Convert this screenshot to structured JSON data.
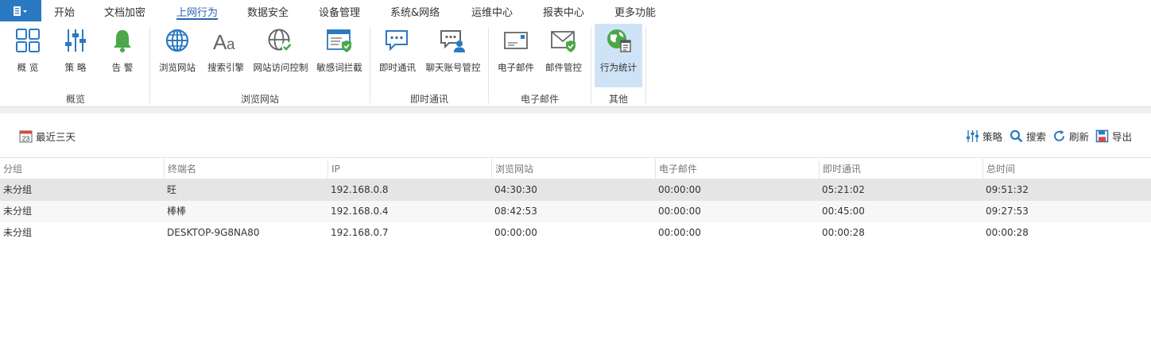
{
  "menubar": {
    "app_button_icon": "app-menu-icon",
    "items": [
      "开始",
      "文档加密",
      "上网行为",
      "数据安全",
      "设备管理",
      "系统&网络",
      "运维中心",
      "报表中心",
      "更多功能"
    ],
    "active": "上网行为"
  },
  "ribbon": {
    "buttons": {
      "overview": "概 览",
      "policy": "策 略",
      "alert": "告 警",
      "browse_site": "浏览网站",
      "search_engine": "搜索引擎",
      "site_access_control": "网站访问控制",
      "sensitive_word_block": "敏感词拦截",
      "instant_message": "即时通讯",
      "chat_account_control": "聊天账号管控",
      "email": "电子邮件",
      "email_control": "邮件管控",
      "behavior_stats": "行为统计"
    },
    "groups": {
      "overview": "概览",
      "browse": "浏览网站",
      "im": "即时通讯",
      "email": "电子邮件",
      "other": "其他"
    },
    "selected_button": "行为统计",
    "accent_color": "#2b79c2",
    "selected_bg": "#cfe3f6"
  },
  "toolbar": {
    "date_range": "最近三天",
    "calendar_day": "23",
    "policy": "策略",
    "search": "搜索",
    "refresh": "刷新",
    "export": "导出"
  },
  "table": {
    "columns": [
      "分组",
      "终端名",
      "IP",
      "浏览网站",
      "电子邮件",
      "即时通讯",
      "总时间"
    ],
    "rows": [
      [
        "未分组",
        "旺",
        "192.168.0.8",
        "04:30:30",
        "00:00:00",
        "05:21:02",
        "09:51:32"
      ],
      [
        "未分组",
        "棒棒",
        "192.168.0.4",
        "08:42:53",
        "00:00:00",
        "00:45:00",
        "09:27:53"
      ],
      [
        "未分组",
        "DESKTOP-9G8NA80",
        "192.168.0.7",
        "00:00:00",
        "00:00:00",
        "00:00:28",
        "00:00:28"
      ]
    ],
    "selected_row": 0
  }
}
